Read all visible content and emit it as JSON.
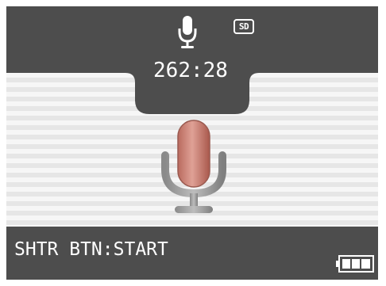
{
  "status": {
    "mode_icon": "microphone-icon",
    "storage_badge": "SD",
    "remaining_time": "262:28"
  },
  "center": {
    "icon": "microphone-icon"
  },
  "footer": {
    "hint": "SHTR BTN:START",
    "battery_icon": "battery-full-icon"
  },
  "colors": {
    "panel": "#4d4d4d",
    "background": "#f2f2f2",
    "mic_red": "#c87a6e",
    "mic_stand": "#9a9a9a"
  }
}
